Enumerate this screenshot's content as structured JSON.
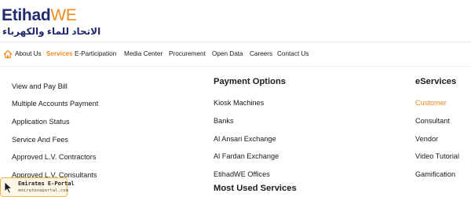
{
  "logo": {
    "en_main": "Etihad",
    "en_accent": "WE",
    "ar": "الاتحاد للماء والكهرباء"
  },
  "nav": {
    "items": [
      "About Us",
      "Services",
      "E-Participation",
      "Media Center",
      "Procurement",
      "Open Data",
      "Careers",
      "Contact Us"
    ],
    "active": "Services"
  },
  "menu": {
    "col1": [
      "View and Pay Bill",
      "Multiple Accounts Payment",
      "Application Status",
      "Service And Fees",
      "Approved L.V. Contractors",
      "Approved L.V. Consultants"
    ],
    "col2_heading": "Payment Options",
    "col2": [
      "Kiosk Machines",
      "Banks",
      "Al Ansari Exchange",
      "Al Fardan Exchange",
      "EtihadWE Offices"
    ],
    "col2_heading2": "Most Used Services",
    "col3_heading": "eServices",
    "col3": [
      "Customer",
      "Consultant",
      "Vendor",
      "Video Tutorial",
      "Gamification"
    ]
  },
  "badge": {
    "title": "Emirates E-Portal",
    "url": "emirateseportal.com"
  },
  "colors": {
    "brand_navy": "#222a6e",
    "brand_orange": "#f28b1e"
  }
}
